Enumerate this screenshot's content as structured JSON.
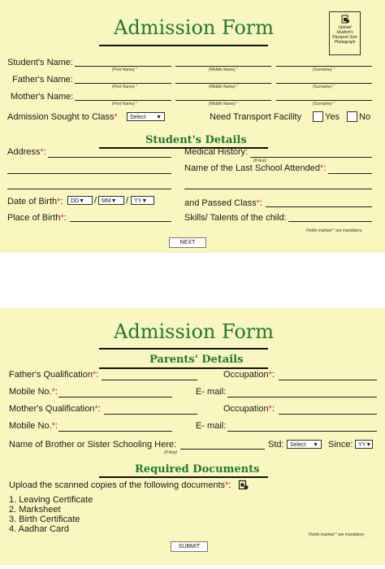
{
  "form_title": "Admission Form",
  "photo_box": {
    "line1": "Upload",
    "line2": "Student's",
    "line3": "Passport Size",
    "line4": "Photograph",
    "icon": "upload-file-icon"
  },
  "page1": {
    "students_name": "Student's Name:",
    "fathers_name": "Father's Name:",
    "mothers_name": "Mother's Name:",
    "first_name_hint": "(First Name)",
    "middle_name_hint": "(Middle Name)",
    "surname_hint": "(Surname)",
    "admission_class": "Admission Sought to Class",
    "class_select": "Select",
    "need_transport": "Need Transport Facility",
    "yes": "Yes",
    "no": "No",
    "section_title": "Student's Details",
    "address": "Address",
    "medical_history": "Medical History:",
    "if_any": "(If Any)",
    "last_school": "Name of the Last School Attended",
    "dob": "Date of Birth",
    "dd": "DD",
    "mm": "MM",
    "yy": "YY",
    "passed_class": "and Passed Class",
    "place_of_birth": "Place of Birth",
    "skills": "Skills/ Talents of the child:",
    "mandatory_note_a": "Fields marked",
    "mandatory_note_b": "are mandatory.",
    "next_button": "NEXT"
  },
  "page2": {
    "section_parents": "Parents' Details",
    "father_qual": "Father's Qualification",
    "occupation": "Occupation",
    "mobile": "Mobile No.",
    "email": "E- mail:",
    "mother_qual": "Mother's Qualification",
    "sibling": "Name of Brother or Sister Schooling Here:",
    "std": "Std:",
    "std_select": "Select",
    "since": "Since:",
    "since_select": "YY",
    "if_any": "(If Any)",
    "section_docs": "Required Documents",
    "upload_text": "Upload the scanned copies of the following documents",
    "documents": [
      "1. Leaving Certificate",
      "2. Marksheet",
      "3. Birth Certificate",
      "4. Aadhar Card"
    ],
    "mandatory_note_a": "Fields marked",
    "mandatory_note_b": "are mandatory.",
    "submit_button": "SUBMIT"
  },
  "colors": {
    "panel_bg": "#faf6bf",
    "title_green": "#1f7a33",
    "required_red": "#e03030"
  }
}
